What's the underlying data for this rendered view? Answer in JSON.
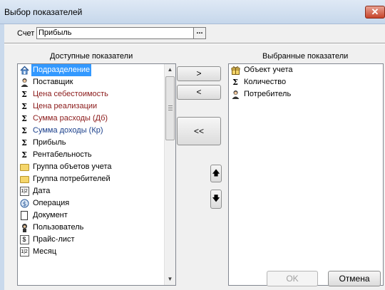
{
  "window": {
    "title": "Выбор показателей",
    "close_label": "✕"
  },
  "account": {
    "label": "Счет",
    "value": "Прибыль",
    "browse_label": "..."
  },
  "available": {
    "header": "Доступные показатели",
    "items": [
      {
        "label": "Подразделение",
        "icon": "house-icon"
      },
      {
        "label": "Поставщик",
        "icon": "person-icon"
      },
      {
        "label": "Цена себестоимость",
        "icon": "sigma-icon"
      },
      {
        "label": "Цена реализации",
        "icon": "sigma-icon"
      },
      {
        "label": "Сумма расходы (Дб)",
        "icon": "sigma-icon"
      },
      {
        "label": "Сумма доходы (Кр)",
        "icon": "sigma-icon"
      },
      {
        "label": "Прибыль",
        "icon": "sigma-icon"
      },
      {
        "label": "Рентабельность",
        "icon": "sigma-icon"
      },
      {
        "label": "Группа объетов учета",
        "icon": "folder-icon"
      },
      {
        "label": "Группа потребителей",
        "icon": "folder-icon"
      },
      {
        "label": "Дата",
        "icon": "calendar-icon"
      },
      {
        "label": "Операция",
        "icon": "operation-icon"
      },
      {
        "label": "Документ",
        "icon": "document-icon"
      },
      {
        "label": "Пользователь",
        "icon": "user-icon"
      },
      {
        "label": "Прайс-лист",
        "icon": "price-icon"
      },
      {
        "label": "Месяц",
        "icon": "calendar-icon"
      }
    ]
  },
  "selected": {
    "header": "Выбранные показатели",
    "items": [
      {
        "label": "Объект учета",
        "icon": "gift-icon"
      },
      {
        "label": "Количество",
        "icon": "sigma-icon"
      },
      {
        "label": "Потребитель",
        "icon": "person-icon"
      }
    ]
  },
  "buttons": {
    "add": ">",
    "remove": "<",
    "remove_all": "<<",
    "move_up": "🡅",
    "move_down": "🡇",
    "ok": "OK",
    "cancel": "Отмена"
  }
}
